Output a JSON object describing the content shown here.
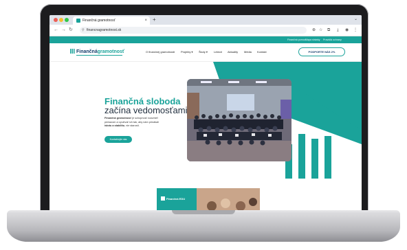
{
  "browser": {
    "tab_title": "Finančná gramotnosť",
    "tab_close": "×",
    "new_tab": "+",
    "url": "financnagramotnost.sk"
  },
  "site": {
    "top_links": [
      "Finančná pomoc",
      "Mapa stránky",
      "Pravidlá ochrany"
    ],
    "logo": {
      "part1": "Finančná",
      "part2": "gramotnosť"
    },
    "menu": [
      "O finančnej gramotnosti",
      "Projekty ▾",
      "Školy ▾",
      "Lektori",
      "Aktuality",
      "Média",
      "Kontakt"
    ],
    "cta": "PODPORTE NÁS 2%",
    "hero": {
      "title_line1": "Finančná sloboda",
      "title_line2": "začína vedomosťami",
      "desc_bold1": "Finančná gramotnosť",
      "desc_text1": " je schopnosť rozumieť peniazom a využívať ich tak, aby nám prinášali ",
      "desc_bold2": "istotu a stabilitu",
      "desc_text2": ", nie starosti.",
      "button": "Kontaktujte nás"
    },
    "promo_label": "Finančná EDU"
  },
  "colors": {
    "brand_teal": "#1aa39a",
    "navy": "#123c6b"
  }
}
